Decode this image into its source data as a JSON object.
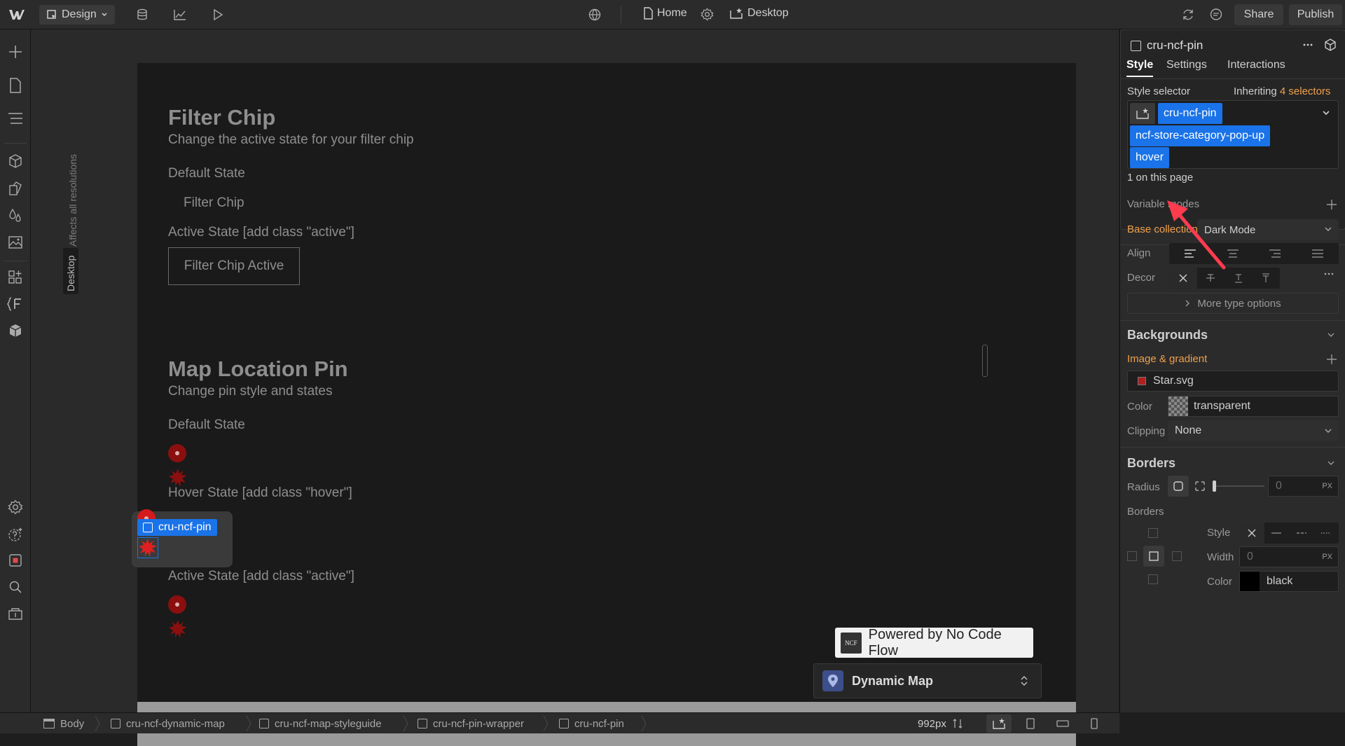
{
  "topbar": {
    "mode_label": "Design",
    "page_label": "Home",
    "breakpoint_label": "Desktop",
    "share_label": "Share",
    "publish_label": "Publish"
  },
  "canvas": {
    "vertical_note": "Affects all resolutions",
    "vertical_tab": "Desktop",
    "filter_title": "Filter Chip",
    "filter_desc": "Change the active state for your filter chip",
    "default_state_label": "Default State",
    "filter_chip_text": "Filter Chip",
    "active_state_label": "Active State [add class \"active\"]",
    "filter_chip_active_text": "Filter Chip Active",
    "map_title": "Map Location Pin",
    "map_desc": "Change pin style and states",
    "pin_default_label": "Default State",
    "pin_hover_label": "Hover State [add class \"hover\"]",
    "pin_active_label": "Active State [add class \"active\"]",
    "selected_element_label": "cru-ncf-pin",
    "ncf_badge_text": "Powered by No Code Flow",
    "ncf_logo_text": "NCF",
    "dynamic_map_label": "Dynamic Map"
  },
  "panel": {
    "element_name": "cru-ncf-pin",
    "tabs": [
      "Style",
      "Settings",
      "Interactions"
    ],
    "active_tab": "Style",
    "style_selector_label": "Style selector",
    "inheriting_prefix": "Inheriting",
    "inheriting_count": "4 selectors",
    "selector_chips": [
      "cru-ncf-pin",
      "ncf-store-category-pop-up",
      "hover"
    ],
    "on_this_page": "1 on this page",
    "variable_modes_label": "Variable modes",
    "base_collection_label": "Base collection",
    "base_collection_value": "Dark Mode",
    "align_label": "Align",
    "decor_label": "Decor",
    "more_type_options": "More type options",
    "backgrounds_title": "Backgrounds",
    "image_gradient_label": "Image & gradient",
    "bg_image_name": "Star.svg",
    "color_label": "Color",
    "bg_color_value": "transparent",
    "clipping_label": "Clipping",
    "clipping_value": "None",
    "borders_title": "Borders",
    "radius_label": "Radius",
    "radius_value": "0",
    "radius_unit": "PX",
    "borders_label": "Borders",
    "border_style_label": "Style",
    "border_width_label": "Width",
    "border_width_value": "0",
    "border_width_unit": "PX",
    "border_color_label": "Color",
    "border_color_value": "black"
  },
  "bottombar": {
    "breadcrumbs": [
      "Body",
      "cru-ncf-dynamic-map",
      "cru-ncf-map-styleguide",
      "cru-ncf-pin-wrapper",
      "cru-ncf-pin"
    ],
    "width_readout": "992px"
  },
  "colors": {
    "accent": "#1a73e8",
    "orange": "#f0a04b",
    "pin_red": "#8b0f0f",
    "arrow_red": "#ff3b4e"
  }
}
